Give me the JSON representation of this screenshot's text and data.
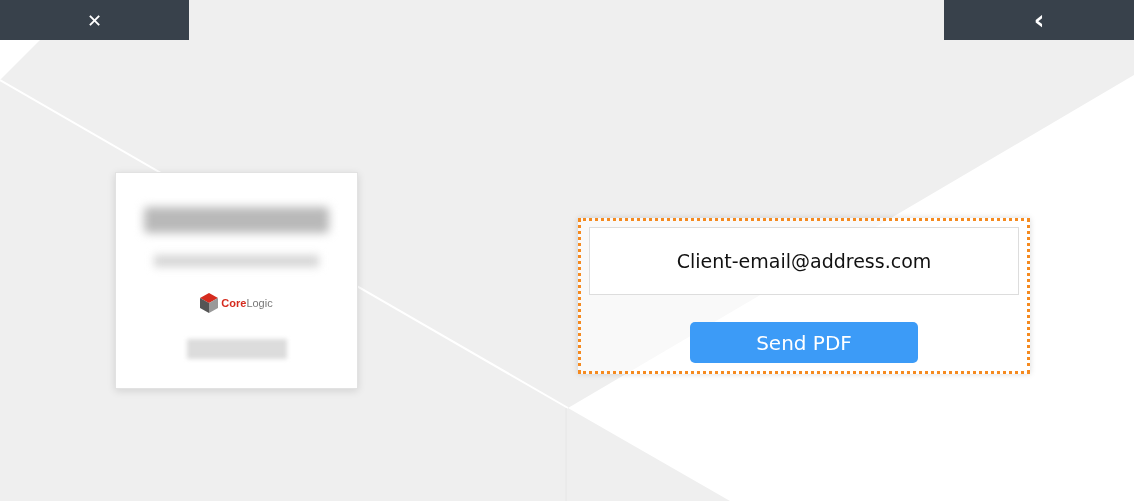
{
  "top_bar": {
    "close_button": {
      "label": "✕"
    },
    "back_button": {
      "label": "‹"
    }
  },
  "card": {
    "logo": {
      "primary": "Core",
      "secondary": "Logic"
    }
  },
  "form": {
    "email_field": {
      "value": "Client-email@address.com"
    },
    "send_button": {
      "label": "Send PDF"
    }
  }
}
